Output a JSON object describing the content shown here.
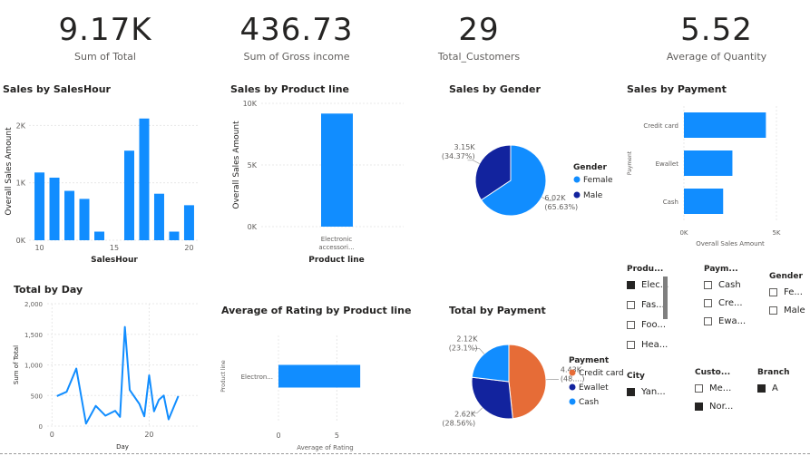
{
  "kpis": [
    {
      "value": "9.17K",
      "label": "Sum of Total"
    },
    {
      "value": "436.73",
      "label": "Sum of Gross income"
    },
    {
      "value": "29",
      "label": "Total_Customers"
    },
    {
      "value": "5.52",
      "label": "Average of Quantity"
    }
  ],
  "visual_titles": {
    "sales_by_hour": "Sales by SalesHour",
    "sales_by_product": "Sales by Product line",
    "sales_by_gender": "Sales by Gender",
    "sales_by_payment": "Sales by Payment",
    "total_by_day": "Total by Day",
    "avg_rating": "Average of Rating by Product line",
    "total_by_payment": "Total by Payment"
  },
  "chart_data": [
    {
      "id": "sales_by_hour",
      "type": "bar",
      "ylabel": "Overall Sales Amount",
      "xlabel": "SalesHour",
      "x": [
        10,
        11,
        12,
        13,
        14,
        16,
        17,
        18,
        19,
        20
      ],
      "values": [
        1180,
        1090,
        860,
        720,
        150,
        1560,
        2120,
        810,
        150,
        610
      ],
      "ylim": [
        0,
        2400
      ],
      "yticks": [
        "0K",
        "1K",
        "2K"
      ],
      "xticks": [
        "10",
        "15",
        "20"
      ],
      "color": "#118dff"
    },
    {
      "id": "sales_by_product",
      "type": "bar",
      "ylabel": "Overall Sales Amount",
      "xlabel": "Product line",
      "categories": [
        "Electronic accessori..."
      ],
      "values": [
        9170
      ],
      "ylim": [
        0,
        10000
      ],
      "yticks": [
        "0K",
        "5K",
        "10K"
      ],
      "color": "#118dff"
    },
    {
      "id": "sales_by_gender",
      "type": "pie",
      "legend_title": "Gender",
      "slices": [
        {
          "name": "Female",
          "value": 6.02,
          "label": "6.02K",
          "pct": "(65.63%)",
          "color": "#118dff"
        },
        {
          "name": "Male",
          "value": 3.15,
          "label": "3.15K",
          "pct": "(34.37%)",
          "color": "#12239e"
        }
      ]
    },
    {
      "id": "sales_by_payment",
      "type": "bar",
      "orientation": "horizontal",
      "ylabel": "Payment",
      "xlabel": "Overall Sales Amount",
      "categories": [
        "Credit card",
        "Ewallet",
        "Cash"
      ],
      "values": [
        4430,
        2620,
        2120
      ],
      "xlim": [
        0,
        5000
      ],
      "xticks": [
        "0K",
        "5K"
      ],
      "color": "#118dff"
    },
    {
      "id": "total_by_day",
      "type": "line",
      "ylabel": "Sum of Total",
      "xlabel": "Day",
      "x": [
        1,
        3,
        5,
        7,
        9,
        11,
        13,
        14,
        15,
        16,
        18,
        19,
        20,
        21,
        22,
        23,
        24,
        26
      ],
      "values": [
        490,
        560,
        940,
        40,
        330,
        170,
        250,
        150,
        1620,
        590,
        360,
        160,
        830,
        240,
        430,
        500,
        110,
        490
      ],
      "ylim": [
        0,
        2000
      ],
      "yticks": [
        "0",
        "500",
        "1,000",
        "1,500",
        "2,000"
      ],
      "xticks": [
        "0",
        "20"
      ],
      "xlim": [
        -1,
        30
      ],
      "color": "#118dff"
    },
    {
      "id": "avg_rating",
      "type": "bar",
      "orientation": "horizontal",
      "ylabel": "Product line",
      "xlabel": "Average of Rating",
      "categories": [
        "Electron..."
      ],
      "values": [
        7.0
      ],
      "xlim": [
        0,
        8
      ],
      "xticks": [
        "0",
        "5"
      ],
      "color": "#118dff"
    },
    {
      "id": "total_by_payment",
      "type": "pie",
      "legend_title": "Payment",
      "slices": [
        {
          "name": "Credit card",
          "value": 4.43,
          "label": "4.43K",
          "pct": "(48....)",
          "color": "#e66c37"
        },
        {
          "name": "Ewallet",
          "value": 2.62,
          "label": "2.62K",
          "pct": "(28.56%)",
          "color": "#12239e"
        },
        {
          "name": "Cash",
          "value": 2.12,
          "label": "2.12K",
          "pct": "(23.1%)",
          "color": "#118dff"
        }
      ]
    }
  ],
  "slicers": [
    {
      "id": "product",
      "title": "Produ...",
      "items": [
        {
          "label": "Elec...",
          "checked": true
        },
        {
          "label": "Fas...",
          "checked": false
        },
        {
          "label": "Foo...",
          "checked": false
        },
        {
          "label": "Hea...",
          "checked": false
        }
      ]
    },
    {
      "id": "payment",
      "title": "Paym...",
      "items": [
        {
          "label": "Cash",
          "checked": false
        },
        {
          "label": "Cre...",
          "checked": false
        },
        {
          "label": "Ewa...",
          "checked": false
        }
      ]
    },
    {
      "id": "gender",
      "title": "Gender",
      "items": [
        {
          "label": "Fe...",
          "checked": false
        },
        {
          "label": "Male",
          "checked": false
        }
      ]
    },
    {
      "id": "city",
      "title": "City",
      "items": [
        {
          "label": "Yan...",
          "checked": true
        }
      ]
    },
    {
      "id": "customer",
      "title": "Custo...",
      "items": [
        {
          "label": "Me...",
          "checked": false
        },
        {
          "label": "Nor...",
          "checked": true
        }
      ]
    },
    {
      "id": "branch",
      "title": "Branch",
      "items": [
        {
          "label": "A",
          "checked": true
        }
      ]
    }
  ]
}
